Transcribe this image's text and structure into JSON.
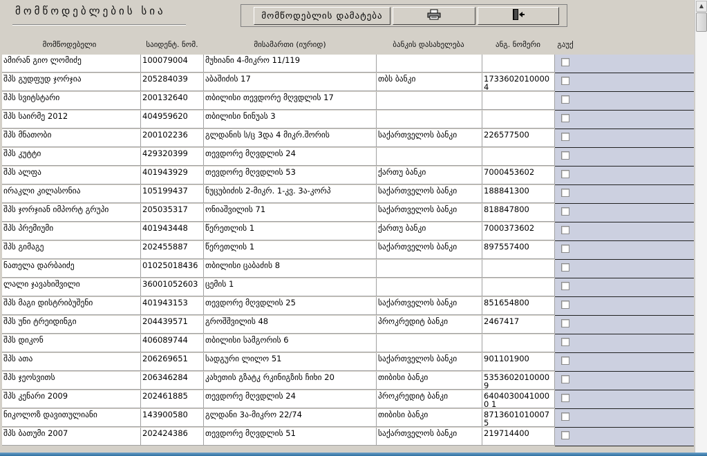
{
  "window_title": "მომწოდებლების სია",
  "toolbar": {
    "add_label": "მომწოდებლის დამატება",
    "print_icon": "printer-icon",
    "exit_icon": "exit-door-icon"
  },
  "columns": [
    "მომწოდებელი",
    "საიდენტ. ნომ.",
    "მისამართი (იურიდ)",
    "ბანკის დასახელება",
    "ანგ. ნომერი",
    "გაუქ"
  ],
  "rows": [
    {
      "name": "ამირან გიო ლომიძე",
      "id": "100079004",
      "address": "მუხიანი 4-მიკრო 11/119",
      "bank": "",
      "account": ""
    },
    {
      "name": "შპს გუდფუდ ჯორჯია",
      "id": "205284039",
      "address": "აბაშიძის 17",
      "bank": "თბს ბანკი",
      "account": "17336020100004"
    },
    {
      "name": "შპს სვიტსტარი",
      "id": "200132640",
      "address": "თბილისი თევდორე მღვდლის 17",
      "bank": "",
      "account": ""
    },
    {
      "name": "შპს საირმე 2012",
      "id": "404959620",
      "address": "თბილისი ნინუას 3",
      "bank": "",
      "account": ""
    },
    {
      "name": "შპს მნათობი",
      "id": "200102236",
      "address": "გლდანის ს/ც 3და 4 მიკრ.შორის",
      "bank": "საქართველოს ბანკი",
      "account": "226577500"
    },
    {
      "name": "შპს კუტტი",
      "id": "429320399",
      "address": "თევდორე მღვდლის 24",
      "bank": "",
      "account": ""
    },
    {
      "name": "შპს ალფა",
      "id": "401943929",
      "address": "თევდორე მღვდლის 53",
      "bank": "ქართუ ბანკი",
      "account": "7000453602"
    },
    {
      "name": "ირაკლი კილასონია",
      "id": "105199437",
      "address": "ნუცუბიძის 2-მიკრ. 1-კვ. 3ა-კორპ",
      "bank": "საქართველოს ბანკი",
      "account": "188841300"
    },
    {
      "name": "შპს ჯორჯიან იმპორტ გრუპი",
      "id": "205035317",
      "address": "ონიაშვილის 71",
      "bank": "საქართველოს ბანკი",
      "account": "818847800"
    },
    {
      "name": "შპს პრემიუმი",
      "id": "401943448",
      "address": "წერეთლის 1",
      "bank": "ქართუ ბანკი",
      "account": "7000373602"
    },
    {
      "name": "შპს გიმაგე",
      "id": "202455887",
      "address": "წერეთლის 1",
      "bank": "საქართველოს ბანკი",
      "account": "897557400"
    },
    {
      "name": "ნათელა დარბაიძე",
      "id": "01025018436",
      "address": "თბილისი ცაბაძის 8",
      "bank": "",
      "account": ""
    },
    {
      "name": "ლალი ჯავახიშვილი",
      "id": "36001052603",
      "address": "ცემის 1",
      "bank": "",
      "account": ""
    },
    {
      "name": "შპს მაგი დისტრიბუშენი",
      "id": "401943153",
      "address": "თევდორე მღვდლის 25",
      "bank": "საქართველოს ბანკი",
      "account": "851654800"
    },
    {
      "name": "შპს უნი ტრეიდინგი",
      "id": "204439571",
      "address": "გროშშვილის 48",
      "bank": "პროკრედიტ ბანკი",
      "account": "2467417"
    },
    {
      "name": "შპს დიკონ",
      "id": "406089744",
      "address": "თბილისი სამგორის 6",
      "bank": "",
      "account": ""
    },
    {
      "name": "შპს ათა",
      "id": "206269651",
      "address": "სადგური ლილო 51",
      "bank": "საქართველოს ბანკი",
      "account": "901101900"
    },
    {
      "name": "შპს ჯეოსვითს",
      "id": "206346284",
      "address": "კახეთის გზატკ რკინიგზის ჩიხი 20",
      "bank": "თიბისი ბანკი",
      "account": "53536020100009"
    },
    {
      "name": "შპს კენარი 2009",
      "id": "202461885",
      "address": "თევდორე მღვდლის 24",
      "bank": "პროკრედიტ ბანკი",
      "account": "64040300410000 1"
    },
    {
      "name": "ნიკოლოზ დავითულიანი",
      "id": "143900580",
      "address": "გლდანი 3ა-მიკრო 22/74",
      "bank": "თიბისი ბანკი",
      "account": "87136010100075"
    },
    {
      "name": "შპს ბათუმი 2007",
      "id": "202424386",
      "address": "თევდორე მღვდლის 51",
      "bank": "საქართველოს ბანკი",
      "account": "219714400"
    }
  ]
}
